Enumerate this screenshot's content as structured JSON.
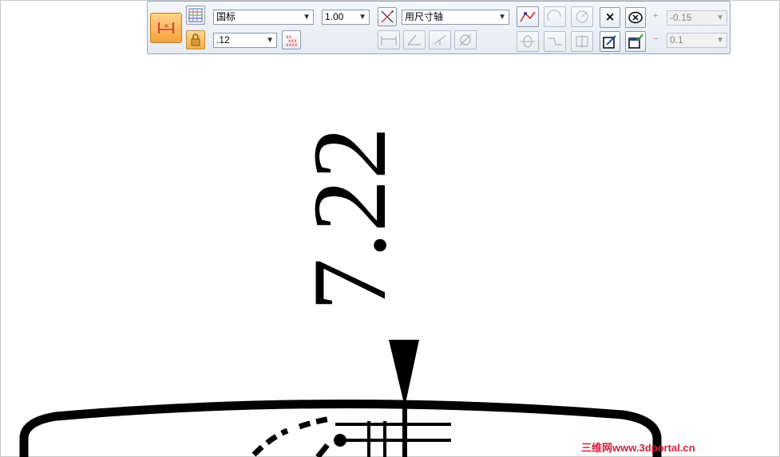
{
  "toolbar": {
    "style_combo": {
      "value": "国标"
    },
    "scale_combo": {
      "value": "1.00"
    },
    "precision_combo": {
      "value": ".12"
    },
    "orientation_combo": {
      "value": "用尺寸轴"
    },
    "upper_tolerance": {
      "sign": "+",
      "value": "-0.15"
    },
    "lower_tolerance": {
      "sign": "−",
      "value": "0.1"
    },
    "close_label": "×"
  },
  "drawing": {
    "dimension_value": "7.22"
  },
  "watermark": "三维网www.3dportal.cn",
  "colors": {
    "accent_orange": "#f6a23a",
    "toolbar_bg": "#e6eaf2",
    "watermark": "#d61e3c"
  }
}
